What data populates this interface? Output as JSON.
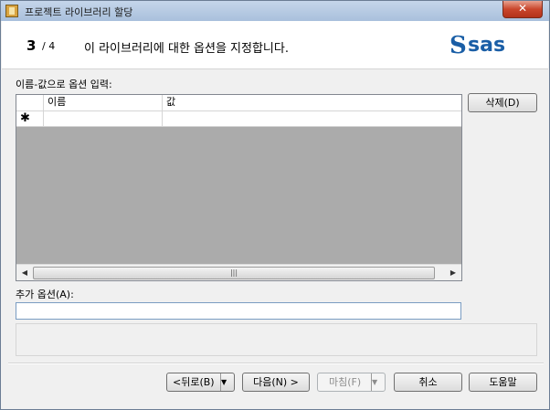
{
  "window": {
    "title": "프로젝트 라이브러리 할당",
    "close_label": "✕"
  },
  "header": {
    "step_current": "3",
    "step_total": "/ 4",
    "text": "이 라이브러리에 대한 옵션을 지정합니다.",
    "logo": "sas",
    "logo_color": "#1a5ea6"
  },
  "options": {
    "label": "이름-값으로 옵션 입력:",
    "columns": [
      "이름",
      "값"
    ],
    "new_row_marker": "✱",
    "delete_button": "삭제(D)"
  },
  "additional": {
    "label": "추가 옵션(A):",
    "value": ""
  },
  "footer": {
    "back": "<뒤로(B)",
    "next": "다음(N) >",
    "finish": "마침(F)",
    "cancel": "취소",
    "help": "도움말"
  }
}
